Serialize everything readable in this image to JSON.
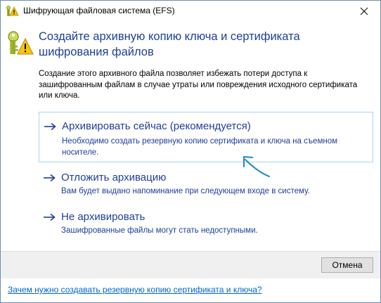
{
  "window": {
    "title": "Шифрующая файловая система (EFS)"
  },
  "header": {
    "heading": "Создайте архивную копию ключа и сертификата шифрования файлов",
    "description": "Создание этого архивного файла позволяет избежать потери доступа к зашифрованным файлам в случае утраты или повреждения исходного сертификата или ключа."
  },
  "options": [
    {
      "title": "Архивировать сейчас (рекомендуется)",
      "description": "Необходимо создать резервную копию сертификата и ключа на съемном носителе."
    },
    {
      "title": "Отложить архивацию",
      "description": "Вам будет выдано напоминание при следующем входе в систему."
    },
    {
      "title": "Не архивировать",
      "description": "Зашифрованные файлы могут стать недоступными."
    }
  ],
  "footer": {
    "cancel_label": "Отмена"
  },
  "help_link": "Зачем нужно создавать резервную копию сертификата и ключа?",
  "colors": {
    "link_blue": "#1f3e99",
    "hyperlink": "#0066cc",
    "hover_border": "#a7d4f2",
    "annotation_arrow": "#1e88c8"
  },
  "icons": {
    "title": "efs-key-warning-icon",
    "header": "key-warning-icon",
    "close": "close-icon",
    "option_arrow": "arrow-right-icon"
  }
}
